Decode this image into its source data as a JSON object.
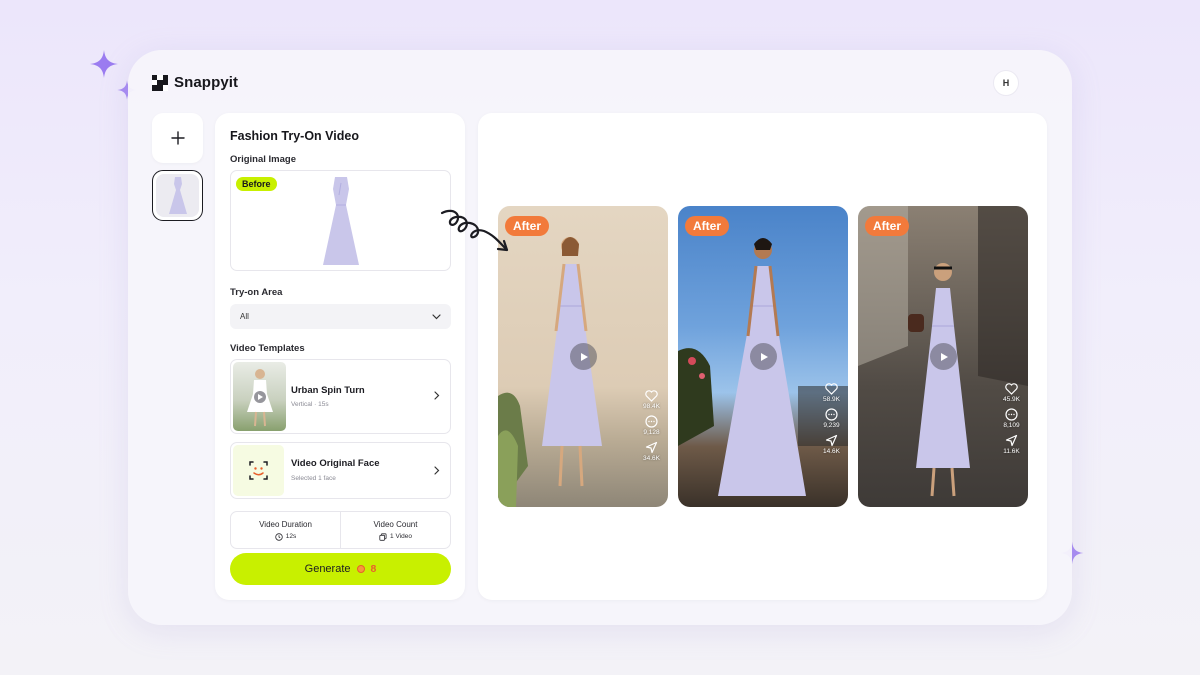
{
  "app": {
    "name": "Snappyit"
  },
  "user": {
    "avatar_initial": "H"
  },
  "sidebar": {
    "add_label": "+"
  },
  "panel": {
    "title": "Fashion Try-On Video",
    "original_image_label": "Original Image",
    "before_badge": "Before",
    "tryon_area_label": "Try-on Area",
    "tryon_area_value": "All",
    "templates_label": "Video Templates",
    "templates": [
      {
        "title": "Urban Spin Turn",
        "subtitle": "Vertical · 15s"
      },
      {
        "title": "Video Original Face",
        "subtitle": "Selected 1 face"
      }
    ],
    "duration_label": "Video Duration",
    "duration_value": "12s",
    "count_label": "Video Count",
    "count_value": "1 Video",
    "generate_label": "Generate",
    "generate_cost": "8"
  },
  "videos": [
    {
      "badge": "After",
      "likes": "98.4K",
      "comments": "9,128",
      "shares": "34.6K"
    },
    {
      "badge": "After",
      "likes": "58.9K",
      "comments": "9,239",
      "shares": "14.6K"
    },
    {
      "badge": "After",
      "likes": "45.9K",
      "comments": "8,109",
      "shares": "11.6K"
    }
  ],
  "colors": {
    "accent_lime": "#c8f000",
    "after_badge": "#f27a3b",
    "sparkle_purple": "#9b7cf0",
    "dress_lavender": "#c9c6ea"
  },
  "icons": [
    "sparkle-icon",
    "plus-icon",
    "chevron-down-icon",
    "chevron-right-icon",
    "clock-icon",
    "copy-icon",
    "coin-icon",
    "play-icon",
    "heart-icon",
    "comment-icon",
    "share-icon",
    "squiggle-arrow-icon"
  ]
}
